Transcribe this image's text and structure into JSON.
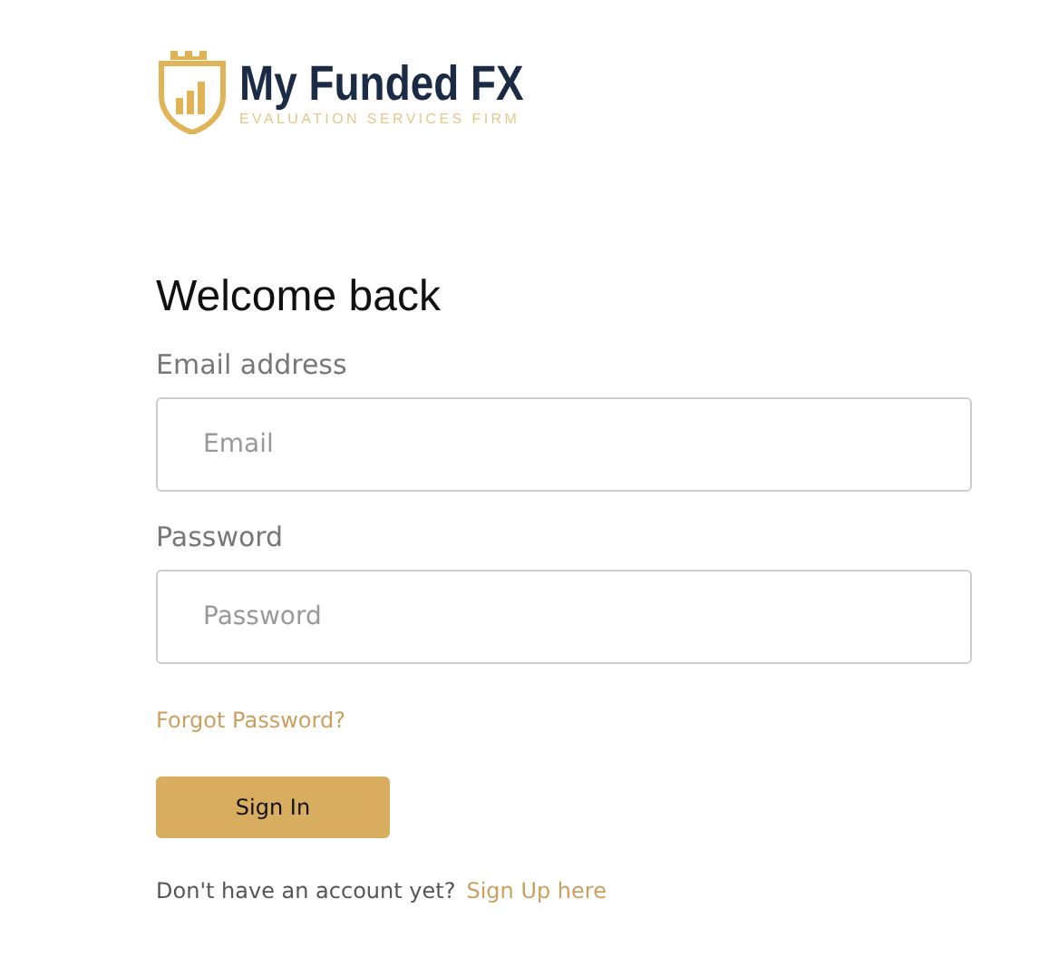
{
  "logo": {
    "name": "My Funded FX",
    "tagline": "EVALUATION SERVICES FIRM"
  },
  "heading": "Welcome back",
  "fields": [
    {
      "label": "Email address",
      "placeholder": "Email"
    },
    {
      "label": "Password",
      "placeholder": "Password"
    }
  ],
  "forgot_link": "Forgot Password?",
  "submit": "Sign In",
  "footer": {
    "text": "Don't have an account yet?",
    "link": "Sign Up here"
  }
}
